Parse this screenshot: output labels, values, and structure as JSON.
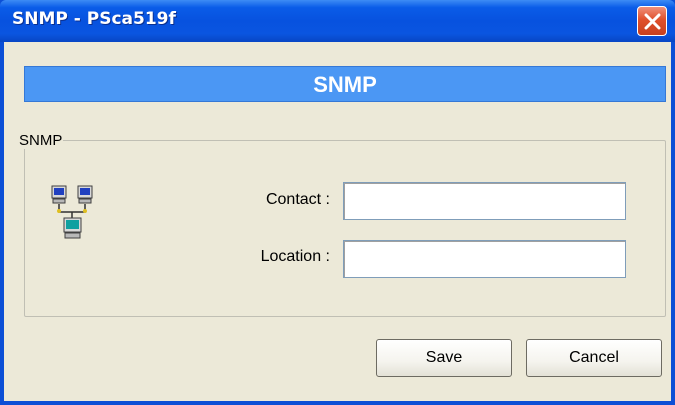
{
  "window": {
    "title": "SNMP - PSca519f",
    "close_icon": "close-icon"
  },
  "header": {
    "title": "SNMP",
    "color": "#4b97f4"
  },
  "group": {
    "label": "SNMP",
    "icon": "network-computers-icon"
  },
  "form": {
    "contact_label": "Contact :",
    "contact_value": "",
    "location_label": "Location :",
    "location_value": ""
  },
  "buttons": {
    "save": "Save",
    "cancel": "Cancel"
  }
}
